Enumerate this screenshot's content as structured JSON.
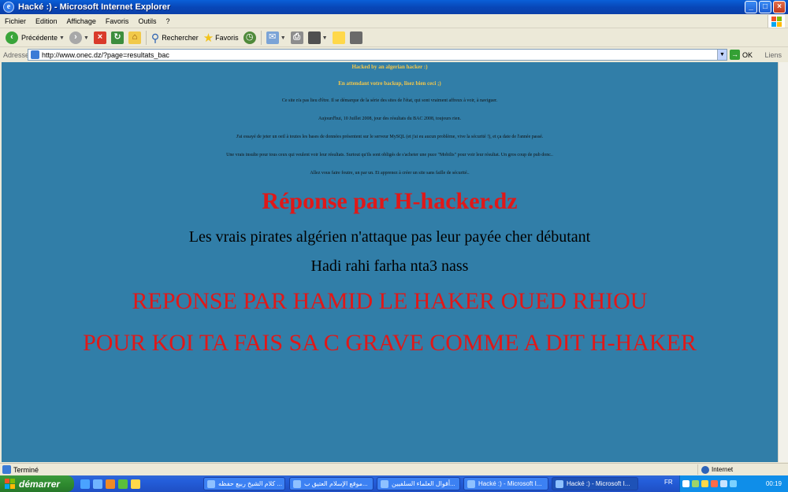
{
  "window": {
    "title": "Hacké :) - Microsoft Internet Explorer",
    "controls": {
      "minimize": "_",
      "maximize": "□",
      "close": "×"
    }
  },
  "menubar": {
    "items": [
      "Fichier",
      "Edition",
      "Affichage",
      "Favoris",
      "Outils",
      "?"
    ]
  },
  "toolbar": {
    "back_label": "Précédente",
    "search_label": "Rechercher",
    "favorites_label": "Favoris"
  },
  "address": {
    "label": "Adresse",
    "url": "http://www.onec.dz/?page=resultats_bac",
    "go_label": "OK",
    "links_label": "Liens"
  },
  "content": {
    "line1": "Hacked by an algerian hacker :)",
    "line2": "En attendant votre backup, lisez bien ceci ;)",
    "para1": "Ce site n'a pas lieu d'être. Il se démarque de la série des sites de l'état, qui sont vraiment affreux à voir, à naviguer.",
    "para2": "Aujourd'hui, 10 Juillet 2008, jour des résultats du BAC 2008, toujours rien.",
    "para3": "J'ai essayé de jeter un oeil à toutes les bases de données présentent sur le serveur MySQL (et j'ai eu aucun problème, vive la sécurité !), et ça date de l'année passé.",
    "para4": "Une vrais insulte pour tous ceux qui veulent voir leur résultats. Surtout qu'ils sont obligés de s'acheter une puce \"Mobilis\" pour voir leur résultat. Un gros coup de pub donc..",
    "para5": "Allez vous faire foutre, un par un. Et apprenez à créer un site sans faille de sécurité..",
    "reply1": "Réponse par H-hacker.dz",
    "reply2": "Les vrais pirates algérien n'attaque pas leur payée cher débutant",
    "reply3": "Hadi rahi farha nta3 nass",
    "reply4": "REPONSE PAR HAMID LE HAKER OUED RHIOU",
    "reply5": "POUR KOI TA FAIS SA C GRAVE  COMME A DIT H-HAKER"
  },
  "statusbar": {
    "status": "Terminé",
    "zone": "Internet"
  },
  "taskbar": {
    "start_label": "démarrer",
    "tasks": [
      "كلام الشيخ ربيع حفظه ...",
      "موقع الإسلام العتيق ب...",
      "أقوال العلماء السلفيين...",
      "Hacké :) - Microsoft I...",
      "Hacké :) - Microsoft I..."
    ],
    "language": "FR",
    "clock": "00:19"
  },
  "colors": {
    "page_background": "#317ea8",
    "heading_yellow": "#f5c84a",
    "reply_red": "#e01818"
  }
}
